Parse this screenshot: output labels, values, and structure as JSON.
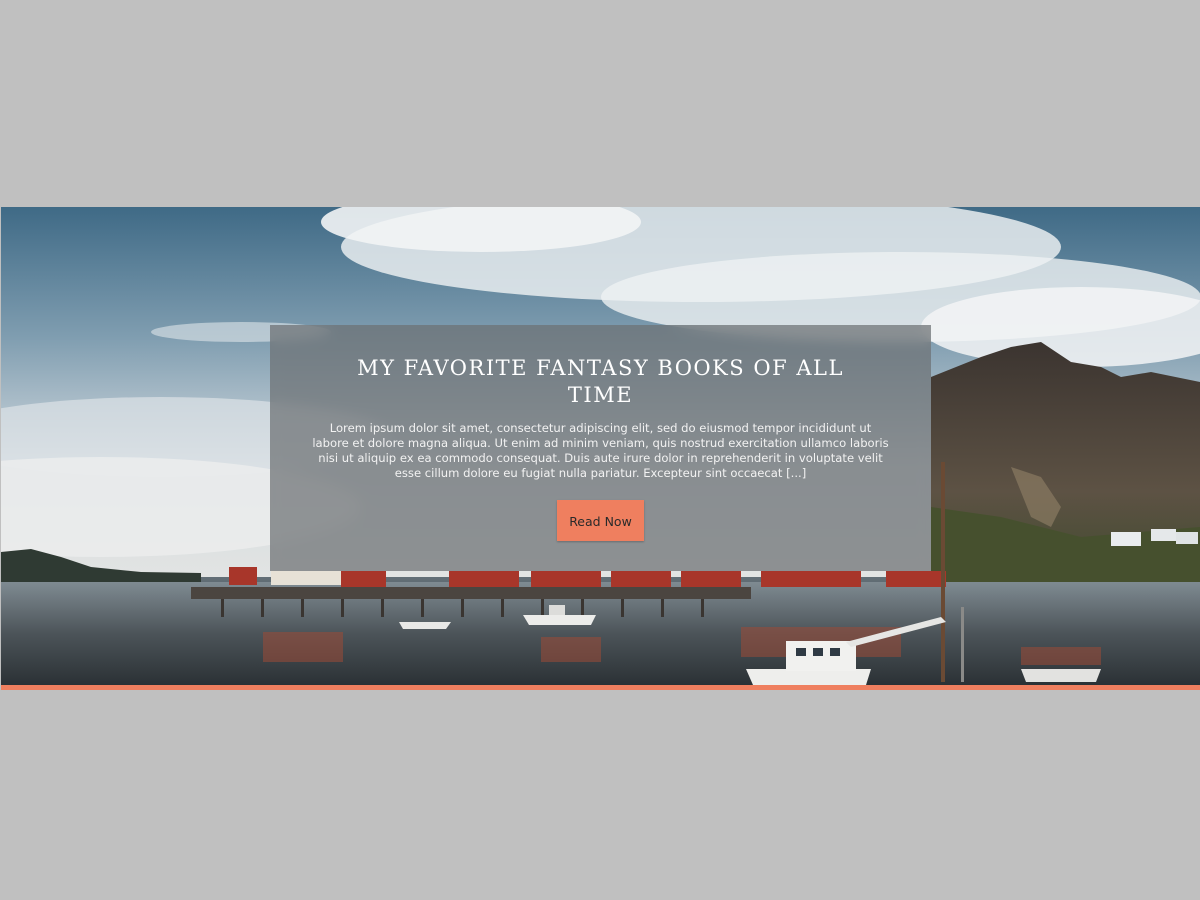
{
  "post": {
    "title": "MY FAVORITE FANTASY BOOKS OF ALL TIME",
    "excerpt": "Lorem ipsum dolor sit amet, consectetur adipiscing elit, sed do eiusmod tempor incididunt ut labore et dolore magna aliqua. Ut enim ad minim veniam, quis nostrud exercitation ullamco laboris nisi ut aliquip ex ea commodo consequat. Duis aute irure dolor in reprehenderit in voluptate velit esse cillum dolore eu fugiat nulla pariatur. Excepteur sint occaecat [...]",
    "read_button_label": "Read Now"
  },
  "colors": {
    "accent": "#ef7f5f",
    "page_background": "#c0c0c0",
    "card_overlay": "#6c7073"
  }
}
